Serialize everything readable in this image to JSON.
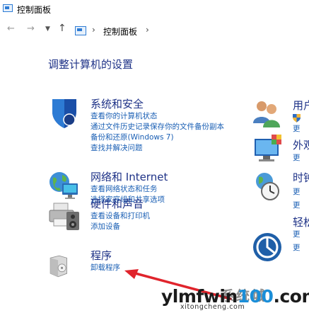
{
  "window": {
    "title": "控制面板"
  },
  "nav": {
    "back": "←",
    "forward": "→",
    "history": "⌄",
    "up": "↑",
    "breadcrumb": {
      "sep1": "›",
      "location": "控制面板",
      "sep2": "›"
    }
  },
  "page": {
    "heading": "调整计算机的设置"
  },
  "categories": [
    {
      "title": "系统和安全",
      "links": [
        "查看你的计算机状态",
        "通过文件历史记录保存你的文件备份副本",
        "备份和还原(Windows 7)",
        "查找并解决问题"
      ]
    },
    {
      "title": "网络和 Internet",
      "links": [
        "查看网络状态和任务",
        "选择家庭组和共享选项"
      ]
    },
    {
      "title": "硬件和声音",
      "links": [
        "查看设备和打印机",
        "添加设备"
      ]
    },
    {
      "title": "程序",
      "links": [
        "卸载程序"
      ]
    }
  ],
  "right_categories": [
    {
      "title": "用户",
      "links": [
        "更"
      ]
    },
    {
      "title": "外观",
      "links": [
        "更"
      ]
    },
    {
      "title": "时钟",
      "links": [
        "更",
        "更"
      ]
    },
    {
      "title": "轻松",
      "links": [
        "更",
        "更"
      ]
    }
  ],
  "watermark": {
    "text_before": "ylmfwin",
    "text_highlight": "100",
    "text_after": ".com",
    "sub": "系统城",
    "url": "xitongcheng.com"
  }
}
